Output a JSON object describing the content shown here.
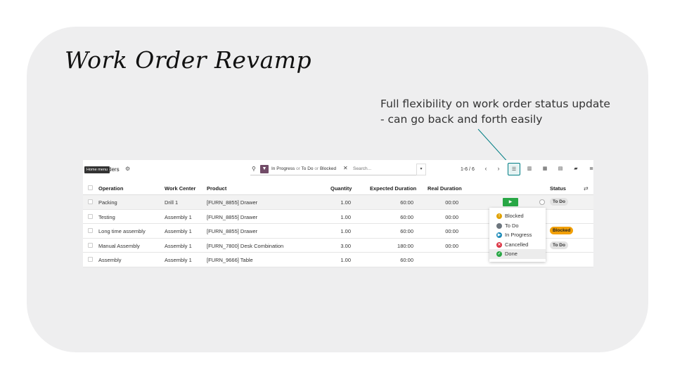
{
  "slide": {
    "title": "Work Order Revamp",
    "callout": "Full flexibility on work order status update - can go back and forth easily"
  },
  "control_panel": {
    "home_tooltip": "Home menu",
    "title_partial": "ders",
    "gear_icon": "gear-icon",
    "search": {
      "facet_in_progress": "In Progress",
      "facet_or_1": "or",
      "facet_to_do": "To Do",
      "facet_or_2": "or",
      "facet_blocked": "Blocked",
      "placeholder": "Search..."
    },
    "pager": "1-6 / 6",
    "views": [
      "list-view-icon",
      "kanban-view-icon",
      "calendar-view-icon",
      "pivot-view-icon",
      "graph-view-icon",
      "gantt-view-icon"
    ]
  },
  "table": {
    "headers": {
      "operation": "Operation",
      "work_center": "Work Center",
      "product": "Product",
      "quantity": "Quantity",
      "expected": "Expected Duration",
      "real": "Real Duration",
      "status": "Status"
    },
    "rows": [
      {
        "operation": "Packing",
        "work_center": "Drill 1",
        "product": "[FURN_8855] Drawer",
        "quantity": "1.00",
        "expected": "60:00",
        "real": "00:00",
        "status": "To Do"
      },
      {
        "operation": "Testing",
        "work_center": "Assembly 1",
        "product": "[FURN_8855] Drawer",
        "quantity": "1.00",
        "expected": "60:00",
        "real": "00:00",
        "status": ""
      },
      {
        "operation": "Long time assembly",
        "work_center": "Assembly 1",
        "product": "[FURN_8855] Drawer",
        "quantity": "1.00",
        "expected": "60:00",
        "real": "00:00",
        "status": "Blocked"
      },
      {
        "operation": "Manual Assembly",
        "work_center": "Assembly 1",
        "product": "[FURN_7800] Desk Combination",
        "quantity": "3.00",
        "expected": "180:00",
        "real": "00:00",
        "status": "To Do"
      },
      {
        "operation": "Assembly",
        "work_center": "Assembly 1",
        "product": "[FURN_9666] Table",
        "quantity": "1.00",
        "expected": "60:00",
        "real": "",
        "status": ""
      }
    ]
  },
  "status_menu": {
    "items": [
      {
        "label": "Blocked",
        "color": "#e0a100",
        "glyph": "!"
      },
      {
        "label": "To Do",
        "color": "#6c757d",
        "glyph": ""
      },
      {
        "label": "In Progress",
        "color": "#1b8ab8",
        "glyph": "▶"
      },
      {
        "label": "Cancelled",
        "color": "#dc3545",
        "glyph": "✕"
      },
      {
        "label": "Done",
        "color": "#28a745",
        "glyph": "✓"
      }
    ]
  },
  "colors": {
    "accent": "#017e84",
    "brand": "#714b67",
    "play_button": "#28a745",
    "blocked_badge": "#f2a007",
    "callout_line": "#017e84"
  }
}
